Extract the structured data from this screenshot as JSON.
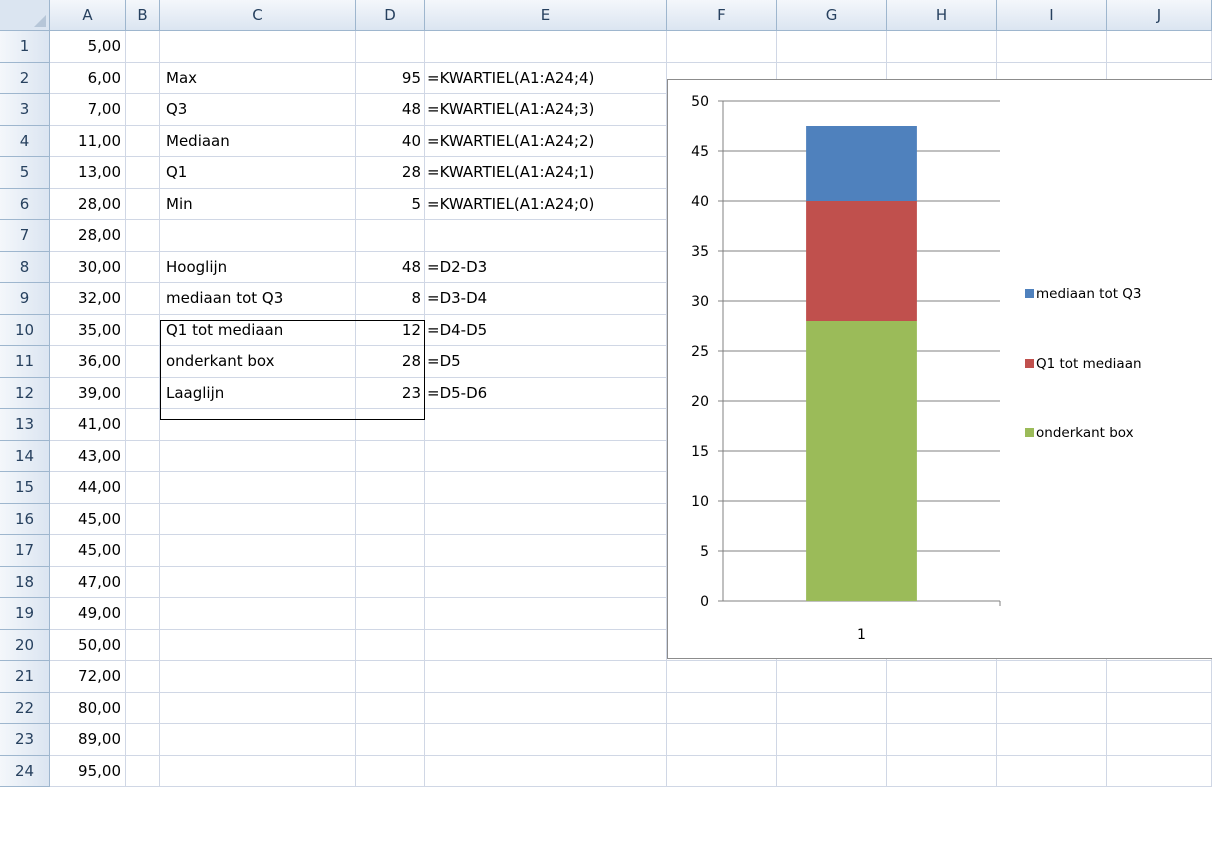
{
  "columns": [
    "A",
    "B",
    "C",
    "D",
    "E",
    "F",
    "G",
    "H",
    "I",
    "J"
  ],
  "rows": [
    "1",
    "2",
    "3",
    "4",
    "5",
    "6",
    "7",
    "8",
    "9",
    "10",
    "11",
    "12",
    "13",
    "14",
    "15",
    "16",
    "17",
    "18",
    "19",
    "20",
    "21",
    "22",
    "23",
    "24"
  ],
  "colA": [
    "5,00",
    "6,00",
    "7,00",
    "11,00",
    "13,00",
    "28,00",
    "28,00",
    "30,00",
    "32,00",
    "35,00",
    "36,00",
    "39,00",
    "41,00",
    "43,00",
    "44,00",
    "45,00",
    "45,00",
    "47,00",
    "49,00",
    "50,00",
    "72,00",
    "80,00",
    "89,00",
    "95,00"
  ],
  "table": [
    {
      "row": 2,
      "label": "Max",
      "value": "95",
      "formula": "=KWARTIEL(A1:A24;4)"
    },
    {
      "row": 3,
      "label": "Q3",
      "value": "48",
      "formula": "=KWARTIEL(A1:A24;3)"
    },
    {
      "row": 4,
      "label": "Mediaan",
      "value": "40",
      "formula": "=KWARTIEL(A1:A24;2)"
    },
    {
      "row": 5,
      "label": "Q1",
      "value": "28",
      "formula": "=KWARTIEL(A1:A24;1)"
    },
    {
      "row": 6,
      "label": "Min",
      "value": "5",
      "formula": "=KWARTIEL(A1:A24;0)"
    },
    {
      "row": 8,
      "label": "Hooglijn",
      "value": "48",
      "formula": "=D2-D3"
    },
    {
      "row": 9,
      "label": "mediaan tot  Q3",
      "value": "8",
      "formula": "=D3-D4"
    },
    {
      "row": 10,
      "label": "Q1 tot mediaan",
      "value": "12",
      "formula": "=D4-D5"
    },
    {
      "row": 11,
      "label": "onderkant box",
      "value": "28",
      "formula": "=D5"
    },
    {
      "row": 12,
      "label": "Laaglijn",
      "value": "23",
      "formula": "=D5-D6"
    }
  ],
  "chart_data": {
    "type": "bar",
    "stacked": true,
    "categories": [
      "1"
    ],
    "series": [
      {
        "name": "onderkant  box",
        "values": [
          28
        ],
        "color": "#9bbb59"
      },
      {
        "name": "Q1 tot mediaan",
        "values": [
          12
        ],
        "color": "#c0504d"
      },
      {
        "name": "mediaan tot  Q3",
        "values": [
          7.5
        ],
        "color": "#4f81bd"
      }
    ],
    "ylim": [
      0,
      50
    ],
    "yticks": [
      "0",
      "5",
      "10",
      "15",
      "20",
      "25",
      "30",
      "35",
      "40",
      "45",
      "50"
    ],
    "grid": true,
    "legend": "right"
  }
}
